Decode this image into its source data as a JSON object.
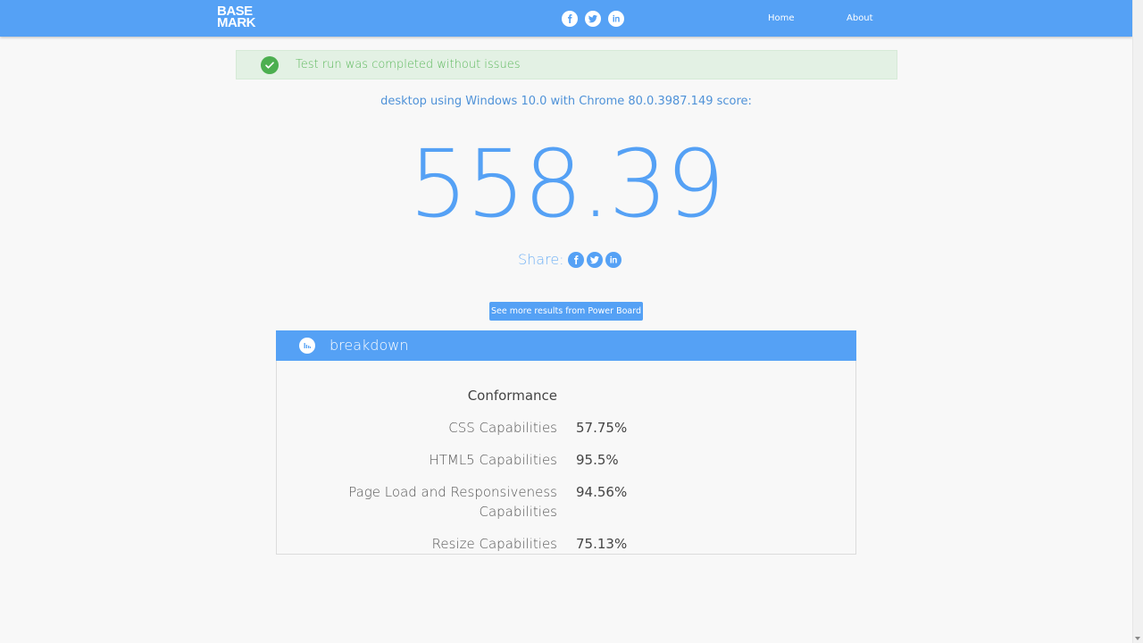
{
  "header": {
    "logo_line1": "BASE",
    "logo_line2": "MARK",
    "nav": [
      {
        "label": "Home"
      },
      {
        "label": "About"
      }
    ],
    "social_icons": [
      "facebook-icon",
      "twitter-icon",
      "linkedin-icon"
    ]
  },
  "alert": {
    "text": "Test run was completed without issues",
    "icon": "check-circle-icon",
    "color": "#5cb85c"
  },
  "test_info": "desktop using Windows 10.0 with Chrome 80.0.3987.149 score:",
  "score": "558.39",
  "share": {
    "label": "Share:"
  },
  "powerboard_button": "See more results from Power Board",
  "breakdown": {
    "title": "breakdown",
    "icon": "bar-chart-icon",
    "category": "Conformance",
    "rows": [
      {
        "label": "CSS Capabilities",
        "value": "57.75%"
      },
      {
        "label": "HTML5 Capabilities",
        "value": "95.5%"
      },
      {
        "label_line1": "Page Load and Responsiveness",
        "label_line2": "Capabilities",
        "value": "94.56%"
      },
      {
        "label": "Resize Capabilities",
        "value": "75.13%"
      }
    ]
  },
  "colors": {
    "accent": "#55a1f5",
    "background": "#f8f8f8",
    "success": "#4caf50"
  }
}
